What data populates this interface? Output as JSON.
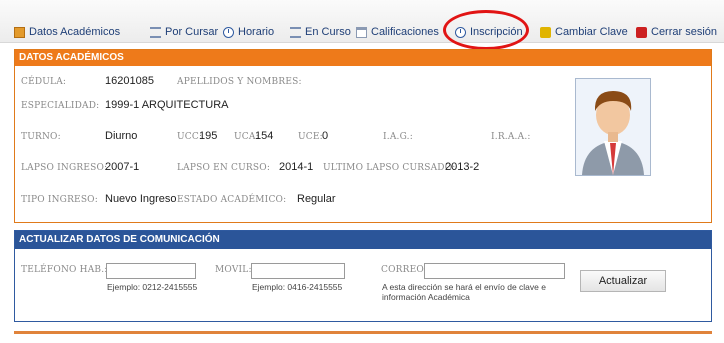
{
  "nav": {
    "items": [
      {
        "label": "Datos Académicos",
        "icon": "book-icon"
      },
      {
        "label": "Por Cursar",
        "icon": "list-icon"
      },
      {
        "label": "Horario",
        "icon": "clock-icon"
      },
      {
        "label": "En Curso",
        "icon": "list-icon"
      },
      {
        "label": "Calificaciones",
        "icon": "calendar-icon"
      },
      {
        "label": "Inscripción",
        "icon": "clock-icon"
      },
      {
        "label": "Cambiar Clave",
        "icon": "key-icon"
      },
      {
        "label": "Cerrar sesión",
        "icon": "power-icon"
      }
    ],
    "highlighted_item": "Inscripción",
    "highlight_color": "#e11414"
  },
  "academic": {
    "header": "DATOS ACADÉMICOS",
    "cedula_label": "CÉDULA:",
    "cedula_value": "16201085",
    "nombres_label": "APELLIDOS Y NOMBRES:",
    "especialidad_label": "ESPECIALIDAD:",
    "especialidad_value": "1999-1 ARQUITECTURA",
    "turno_label": "TURNO:",
    "turno_value": "Diurno",
    "ucc_label": "UCC:",
    "ucc_value": "195",
    "uca_label": "UCA:",
    "uca_value": "154",
    "uce_label": "UCE:",
    "uce_value": "0",
    "iag_label": "I.A.G.:",
    "iraa_label": "I.R.A.A.:",
    "lapso_ingreso_label": "LAPSO INGRESO:",
    "lapso_ingreso_value": "2007-1",
    "lapso_curso_label": "LAPSO EN CURSO:",
    "lapso_curso_value": "2014-1",
    "ultimo_lapso_label": "ULTIMO LAPSO CURSADO:",
    "ultimo_lapso_value": "2013-2",
    "tipo_ingreso_label": "TIPO INGRESO:",
    "tipo_ingreso_value": "Nuevo Ingreso",
    "estado_label": "ESTADO ACADÉMICO:",
    "estado_value": "Regular",
    "header_color": "#ee7a1a"
  },
  "contact": {
    "header": "ACTUALIZAR DATOS DE COMUNICACIÓN",
    "telefono_label": "TELÉFONO HAB.:",
    "telefono_hint": "Ejemplo: 0212-2415555",
    "movil_label": "MOVIL:",
    "movil_hint": "Ejemplo: 0416-2415555",
    "correo_label": "CORREO:",
    "correo_hint": "A esta dirección se hará el envío de clave e información Académica",
    "button_label": "Actualizar",
    "header_color": "#2b5599"
  }
}
